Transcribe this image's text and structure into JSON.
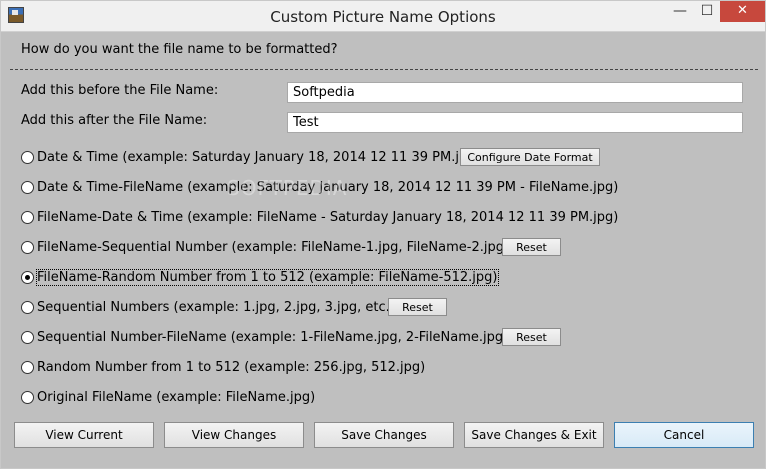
{
  "window": {
    "title": "Custom Picture Name Options",
    "min_glyph": "—",
    "max_glyph": "☐",
    "close_glyph": "✕"
  },
  "question": "How do you want the file name to be formatted?",
  "prefix": {
    "label": "Add this before the File Name:",
    "value": "Softpedia"
  },
  "suffix": {
    "label": "Add this after the File Name:",
    "value": "Test"
  },
  "options": [
    {
      "label": "Date & Time (example: Saturday January 18, 2014 12 11 39 PM.jpg)",
      "selected": false
    },
    {
      "label": "Date & Time-FileName (example: Saturday January 18, 2014 12 11 39 PM - FileName.jpg)",
      "selected": false
    },
    {
      "label": "FileName-Date & Time (example: FileName - Saturday January 18, 2014 12 11 39 PM.jpg)",
      "selected": false
    },
    {
      "label": "FileName-Sequential Number (example: FileName-1.jpg, FileName-2.jpg)",
      "selected": false
    },
    {
      "label": "FileName-Random Number from 1 to 512 (example: FileName-512.jpg)",
      "selected": true
    },
    {
      "label": "Sequential Numbers (example: 1.jpg, 2.jpg, 3.jpg, etc...)",
      "selected": false
    },
    {
      "label": "Sequential Number-FileName (example: 1-FileName.jpg, 2-FileName.jpg)",
      "selected": false
    },
    {
      "label": "Random Number from 1 to 512 (example: 256.jpg, 512.jpg)",
      "selected": false
    },
    {
      "label": "Original FileName (example: FileName.jpg)",
      "selected": false
    }
  ],
  "buttons": {
    "configure_date": "Configure Date Format",
    "reset": "Reset",
    "view_current": "View Current",
    "view_changes": "View Changes",
    "save_changes": "Save Changes",
    "save_exit": "Save Changes & Exit",
    "cancel": "Cancel"
  },
  "watermark": "SOFTPEDIA"
}
